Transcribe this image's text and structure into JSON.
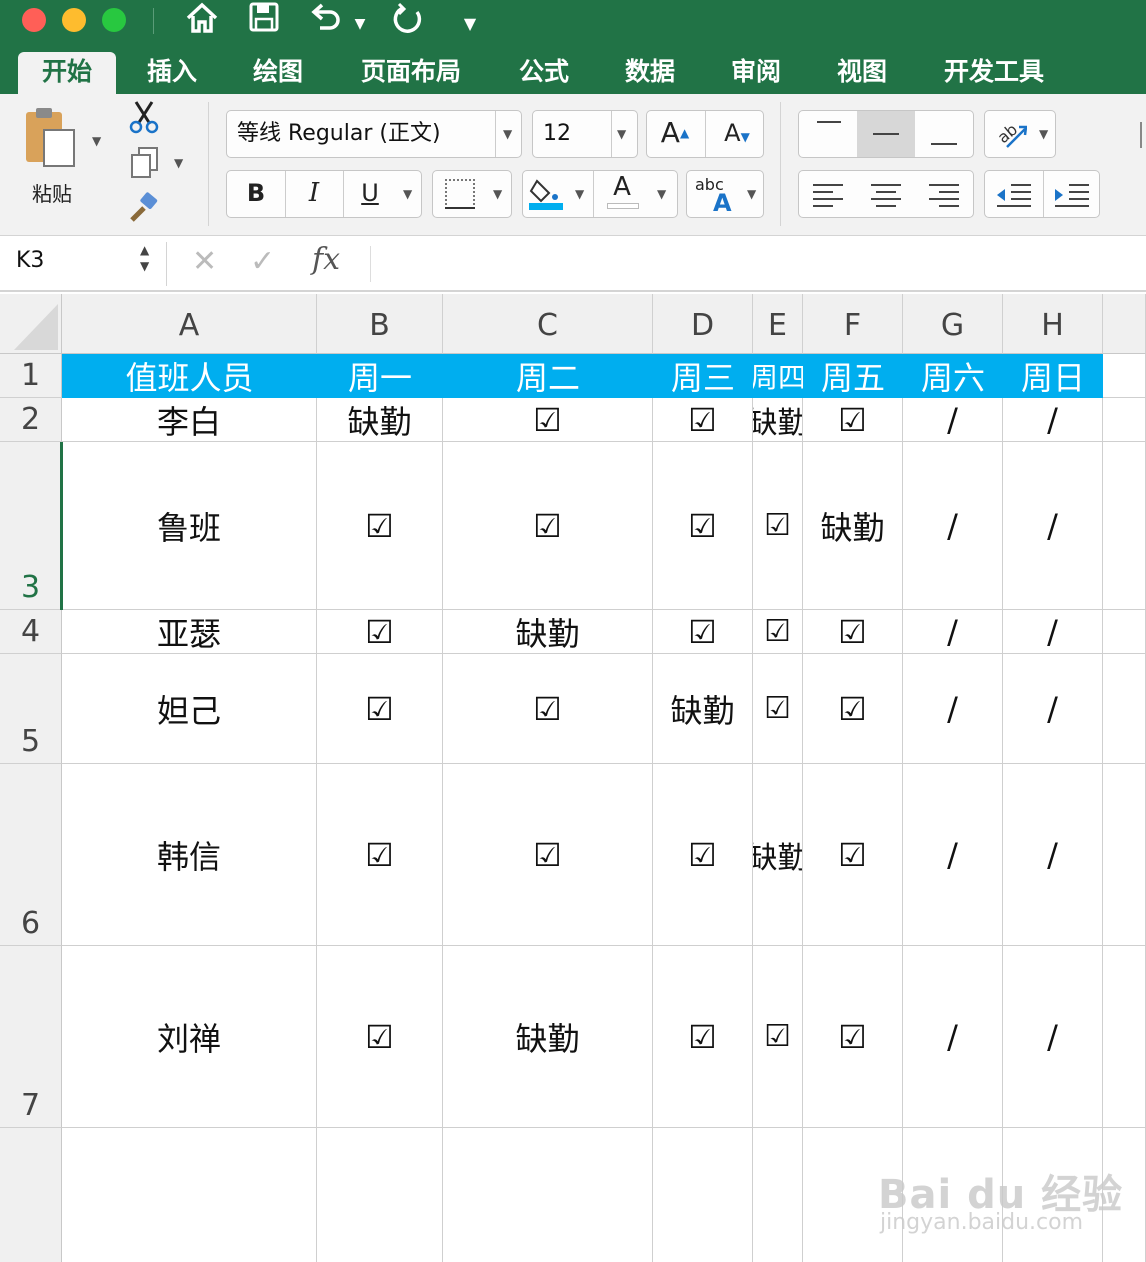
{
  "window": {
    "traffic_lights": [
      "#ff5f57",
      "#febc2e",
      "#28c840"
    ],
    "quick_access_icons": [
      "home-icon",
      "save-icon",
      "undo-icon",
      "redo-icon",
      "customize-icon"
    ]
  },
  "tabs": [
    "开始",
    "插入",
    "绘图",
    "页面布局",
    "公式",
    "数据",
    "审阅",
    "视图",
    "开发工具"
  ],
  "ribbon": {
    "paste_label": "粘贴",
    "font_name": "等线 Regular (正文)",
    "font_size": "12",
    "grow_font": "A",
    "shrink_font": "A",
    "bold": "B",
    "italic": "I",
    "underline": "U",
    "font_color_letter": "A",
    "abc_label": "abc",
    "abc_A": "A"
  },
  "formula_bar": {
    "name_box": "K3",
    "fx": "fx",
    "formula": ""
  },
  "sheet": {
    "columns": [
      "A",
      "B",
      "C",
      "D",
      "E",
      "F",
      "G",
      "H"
    ],
    "rows": [
      "1",
      "2",
      "3",
      "4",
      "5",
      "6",
      "7"
    ],
    "header_color": "#00aeef",
    "header": [
      "值班人员",
      "周一",
      "周二",
      "周三",
      "周四",
      "周五",
      "周六",
      "周日"
    ],
    "data": [
      [
        "李白",
        "缺勤",
        "☑",
        "☑",
        "缺勤",
        "☑",
        "/",
        "/"
      ],
      [
        "鲁班",
        "☑",
        "☑",
        "☑",
        "☑",
        "缺勤",
        "/",
        "/"
      ],
      [
        "亚瑟",
        "☑",
        "缺勤",
        "☑",
        "☑",
        "☑",
        "/",
        "/"
      ],
      [
        "妲己",
        "☑",
        "☑",
        "缺勤",
        "☑",
        "☑",
        "/",
        "/"
      ],
      [
        "韩信",
        "☑",
        "☑",
        "☑",
        "缺勤",
        "☑",
        "/",
        "/"
      ],
      [
        "刘禅",
        "☑",
        "缺勤",
        "☑",
        "☑",
        "☑",
        "/",
        "/"
      ]
    ]
  },
  "watermark": {
    "brand": "Bai du 经验",
    "url": "jingyan.baidu.com"
  }
}
